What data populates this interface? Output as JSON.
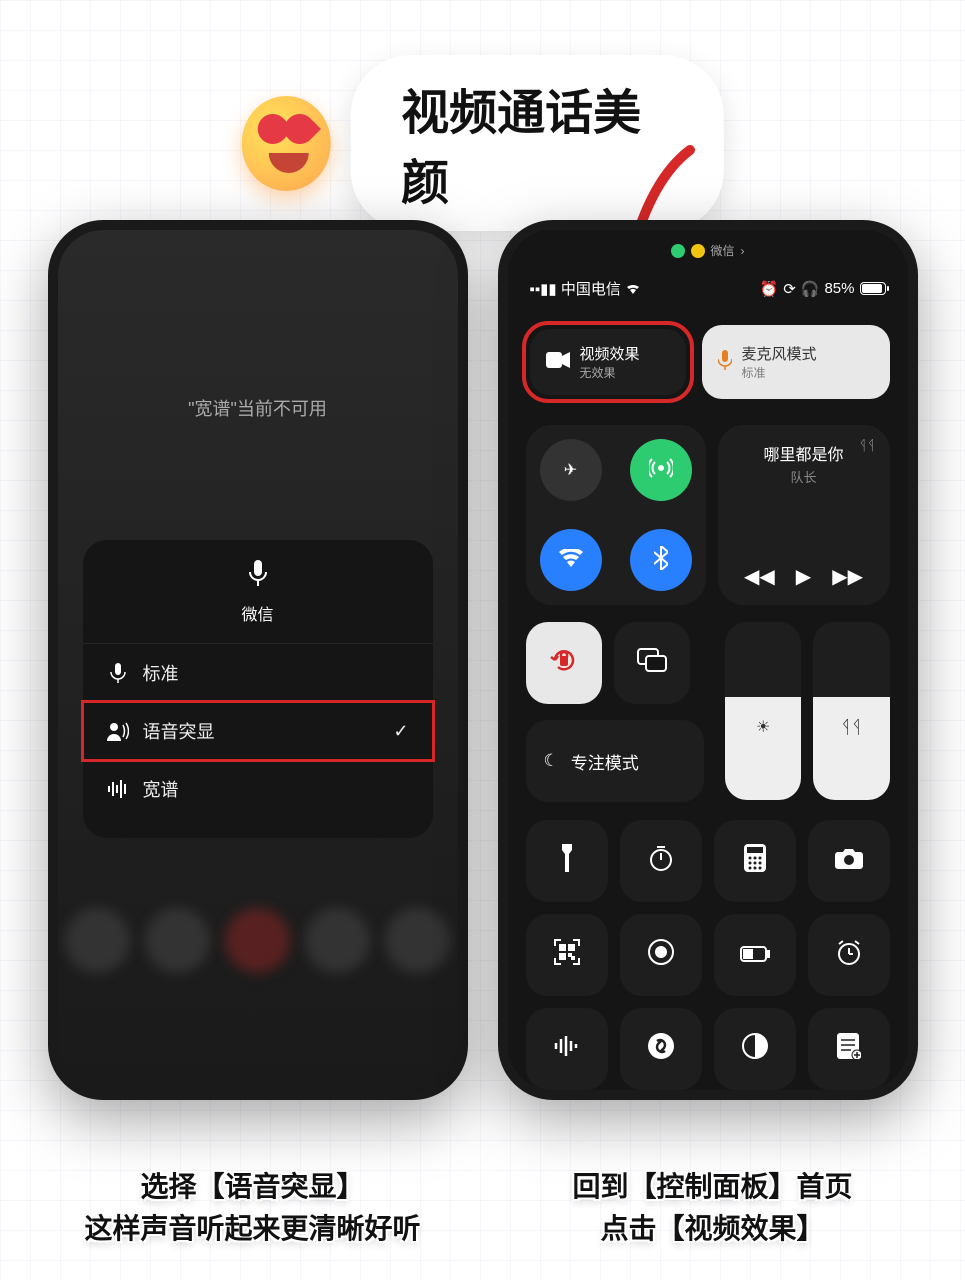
{
  "banner": {
    "title": "视频通话美颜"
  },
  "left_phone": {
    "notice": "\"宽谱\"当前不可用",
    "panel_app": "微信",
    "options": {
      "standard": "标准",
      "voice_isolation": "语音突显",
      "wide_spectrum": "宽谱"
    }
  },
  "right_phone": {
    "pill_app": "微信",
    "carrier": "中国电信",
    "battery": "85%",
    "video_effect": {
      "title": "视频效果",
      "sub": "无效果"
    },
    "mic_mode": {
      "title": "麦克风模式",
      "sub": "标准"
    },
    "now_playing": {
      "title": "哪里都是你",
      "artist": "队长"
    },
    "focus": "专注模式"
  },
  "captions": {
    "left_l1": "选择【语音突显】",
    "left_l2": "这样声音听起来更清晰好听",
    "right_l1": "回到【控制面板】首页",
    "right_l2": "点击【视频效果】"
  }
}
